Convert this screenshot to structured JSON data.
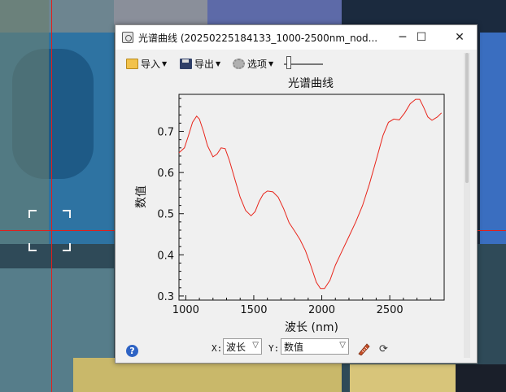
{
  "window": {
    "title": "光谱曲线 (20250225184133_1000-2500nm_nod...",
    "minimize_glyph": "─",
    "maximize_glyph": "☐",
    "close_glyph": "✕"
  },
  "toolbar": {
    "import_label": "导入",
    "export_label": "导出",
    "options_label": "选项",
    "icons": [
      "folder-icon",
      "floppy-icon",
      "gear-icon"
    ]
  },
  "controls": {
    "x_label": "X:",
    "x_value": "波长",
    "y_label": "Y:",
    "y_value": "数值",
    "help_glyph": "?",
    "refresh_glyph": "⟳"
  },
  "chart_data": {
    "type": "line",
    "title": "光谱曲线",
    "xlabel": "波长 (nm)",
    "ylabel": "数值",
    "xlim": [
      950,
      2900
    ],
    "ylim": [
      0.29,
      0.79
    ],
    "xticks": [
      1000,
      1500,
      2000,
      2500
    ],
    "yticks": [
      0.3,
      0.4,
      0.5,
      0.6,
      0.7
    ],
    "ytick_labels": [
      "0.3",
      "0.4",
      "0.5",
      "0.6",
      "0.7"
    ],
    "line_color": "#e8261c",
    "grid": false,
    "series": [
      {
        "x": [
          950,
          990,
          1020,
          1050,
          1080,
          1100,
          1130,
          1160,
          1200,
          1230,
          1260,
          1290,
          1320,
          1360,
          1400,
          1440,
          1480,
          1510,
          1540,
          1570,
          1600,
          1640,
          1680,
          1720,
          1760,
          1800,
          1840,
          1880,
          1920,
          1960,
          1990,
          2020,
          2060,
          2100,
          2150,
          2200,
          2250,
          2300,
          2350,
          2400,
          2450,
          2490,
          2530,
          2570,
          2610,
          2650,
          2690,
          2720,
          2750,
          2780,
          2810,
          2850,
          2880
        ],
        "y": [
          0.648,
          0.66,
          0.69,
          0.722,
          0.737,
          0.73,
          0.7,
          0.665,
          0.638,
          0.645,
          0.66,
          0.658,
          0.63,
          0.585,
          0.54,
          0.508,
          0.495,
          0.505,
          0.53,
          0.548,
          0.555,
          0.553,
          0.54,
          0.512,
          0.478,
          0.458,
          0.437,
          0.41,
          0.373,
          0.333,
          0.318,
          0.318,
          0.338,
          0.375,
          0.41,
          0.445,
          0.48,
          0.52,
          0.572,
          0.63,
          0.69,
          0.722,
          0.73,
          0.728,
          0.745,
          0.767,
          0.778,
          0.778,
          0.758,
          0.735,
          0.727,
          0.735,
          0.745
        ]
      }
    ]
  }
}
